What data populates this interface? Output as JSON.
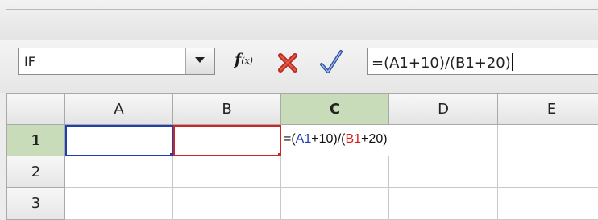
{
  "name_box": {
    "value": "IF"
  },
  "formula_bar": {
    "fx_label": "f",
    "fx_sub": "(x)",
    "formula": "=(A1+10)/(B1+20)"
  },
  "columns": [
    "A",
    "B",
    "C",
    "D",
    "E"
  ],
  "active_column": "C",
  "rows": [
    "1",
    "2",
    "3"
  ],
  "active_row": "1",
  "cell_c1": {
    "parts": [
      "=(",
      "A1",
      "+10)/(",
      "B1",
      "+20)"
    ]
  },
  "colors": {
    "ref_a": "#1f3fb0",
    "ref_b": "#d12424",
    "active_header": "#c9dcba",
    "cancel": "#c0392b",
    "accept": "#2b4fa0"
  },
  "icons": [
    "chevron-down-icon",
    "function-wizard-icon",
    "cancel-icon",
    "accept-icon"
  ]
}
